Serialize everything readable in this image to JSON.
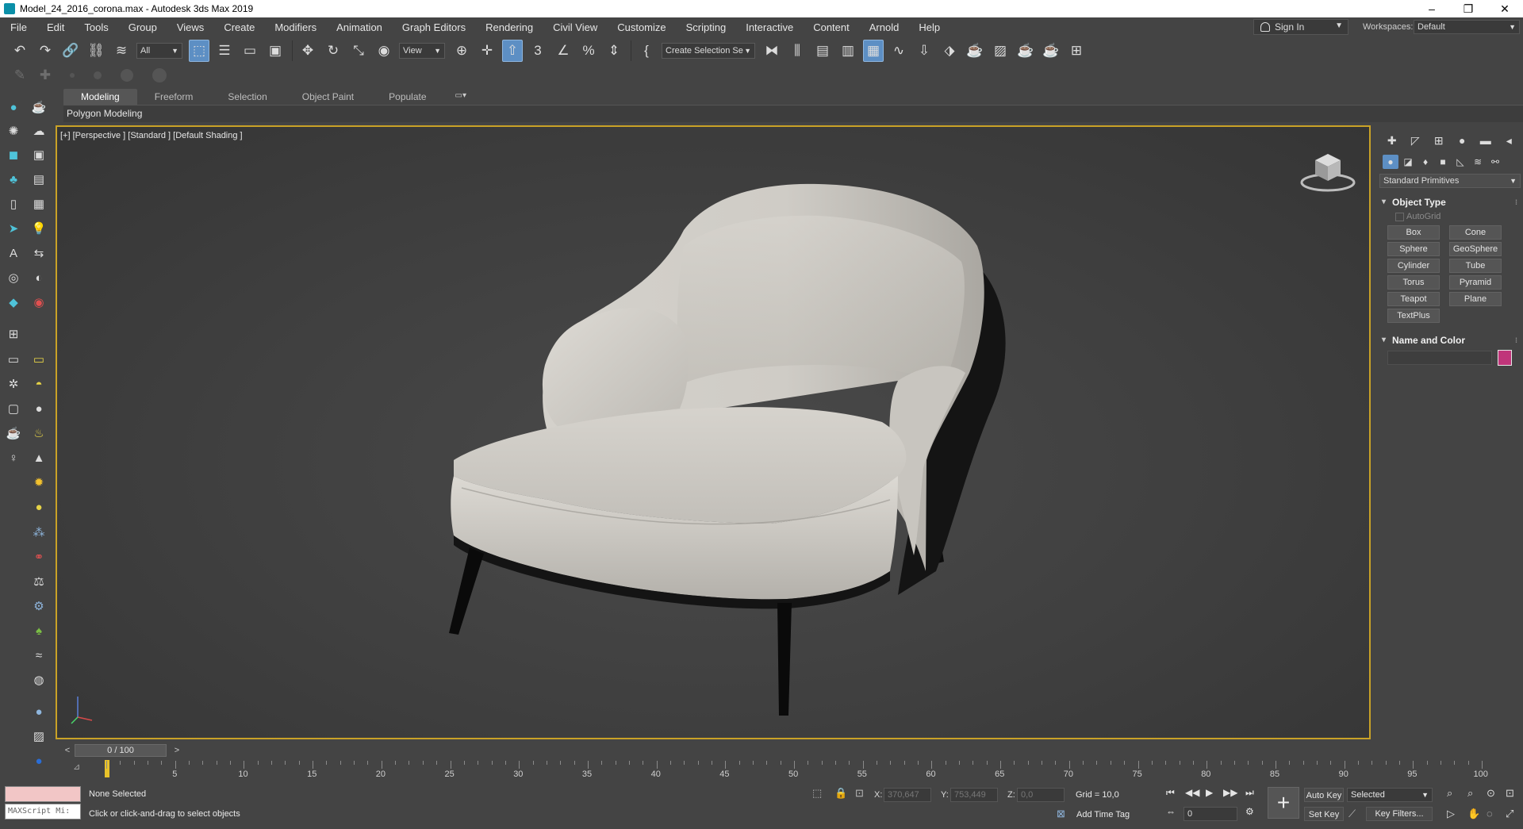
{
  "window": {
    "title": "Model_24_2016_corona.max - Autodesk 3ds Max 2019",
    "minimize": "–",
    "restore": "❐",
    "close": "✕"
  },
  "menu": {
    "items": [
      "File",
      "Edit",
      "Tools",
      "Group",
      "Views",
      "Create",
      "Modifiers",
      "Animation",
      "Graph Editors",
      "Rendering",
      "Civil View",
      "Customize",
      "Scripting",
      "Interactive",
      "Content",
      "Arnold",
      "Help"
    ],
    "signin": "Sign In",
    "workspaces_label": "Workspaces:",
    "workspace_value": "Default"
  },
  "toolbar": {
    "selection_filter": "All",
    "ref_coord": "View",
    "named_selection": "Create Selection Se"
  },
  "ribbon": {
    "tabs": [
      "Modeling",
      "Freeform",
      "Selection",
      "Object Paint",
      "Populate"
    ],
    "active_tab": "Modeling",
    "panel_label": "Polygon Modeling"
  },
  "viewport": {
    "label": "[+] [Perspective ] [Standard ] [Default Shading ]"
  },
  "command_panel": {
    "category": "Standard Primitives",
    "object_type": {
      "title": "Object Type",
      "autogrid": "AutoGrid",
      "buttons": [
        "Box",
        "Cone",
        "Sphere",
        "GeoSphere",
        "Cylinder",
        "Tube",
        "Torus",
        "Pyramid",
        "Teapot",
        "Plane",
        "TextPlus"
      ]
    },
    "name_and_color": {
      "title": "Name and Color",
      "color": "#c0357a"
    }
  },
  "timeline": {
    "prev": "<",
    "next": ">",
    "frame_display": "0 / 100",
    "tick_labels": [
      "5",
      "10",
      "15",
      "20",
      "25",
      "30",
      "35",
      "40",
      "45",
      "50",
      "55",
      "60",
      "65",
      "70",
      "75",
      "80",
      "85",
      "90",
      "95",
      "100"
    ]
  },
  "status": {
    "maxscript_placeholder": "MAXScript Mi:",
    "selection": "None Selected",
    "prompt": "Click or click-and-drag to select objects",
    "x_label": "X:",
    "x_value": "370,647",
    "y_label": "Y:",
    "y_value": "753,449",
    "z_label": "Z:",
    "z_value": "0,0",
    "grid": "Grid = 10,0",
    "add_time_tag": "Add Time Tag",
    "auto_key": "Auto Key",
    "set_key": "Set Key",
    "key_mode": "Selected",
    "key_filters": "Key Filters...",
    "current_frame": "0"
  }
}
